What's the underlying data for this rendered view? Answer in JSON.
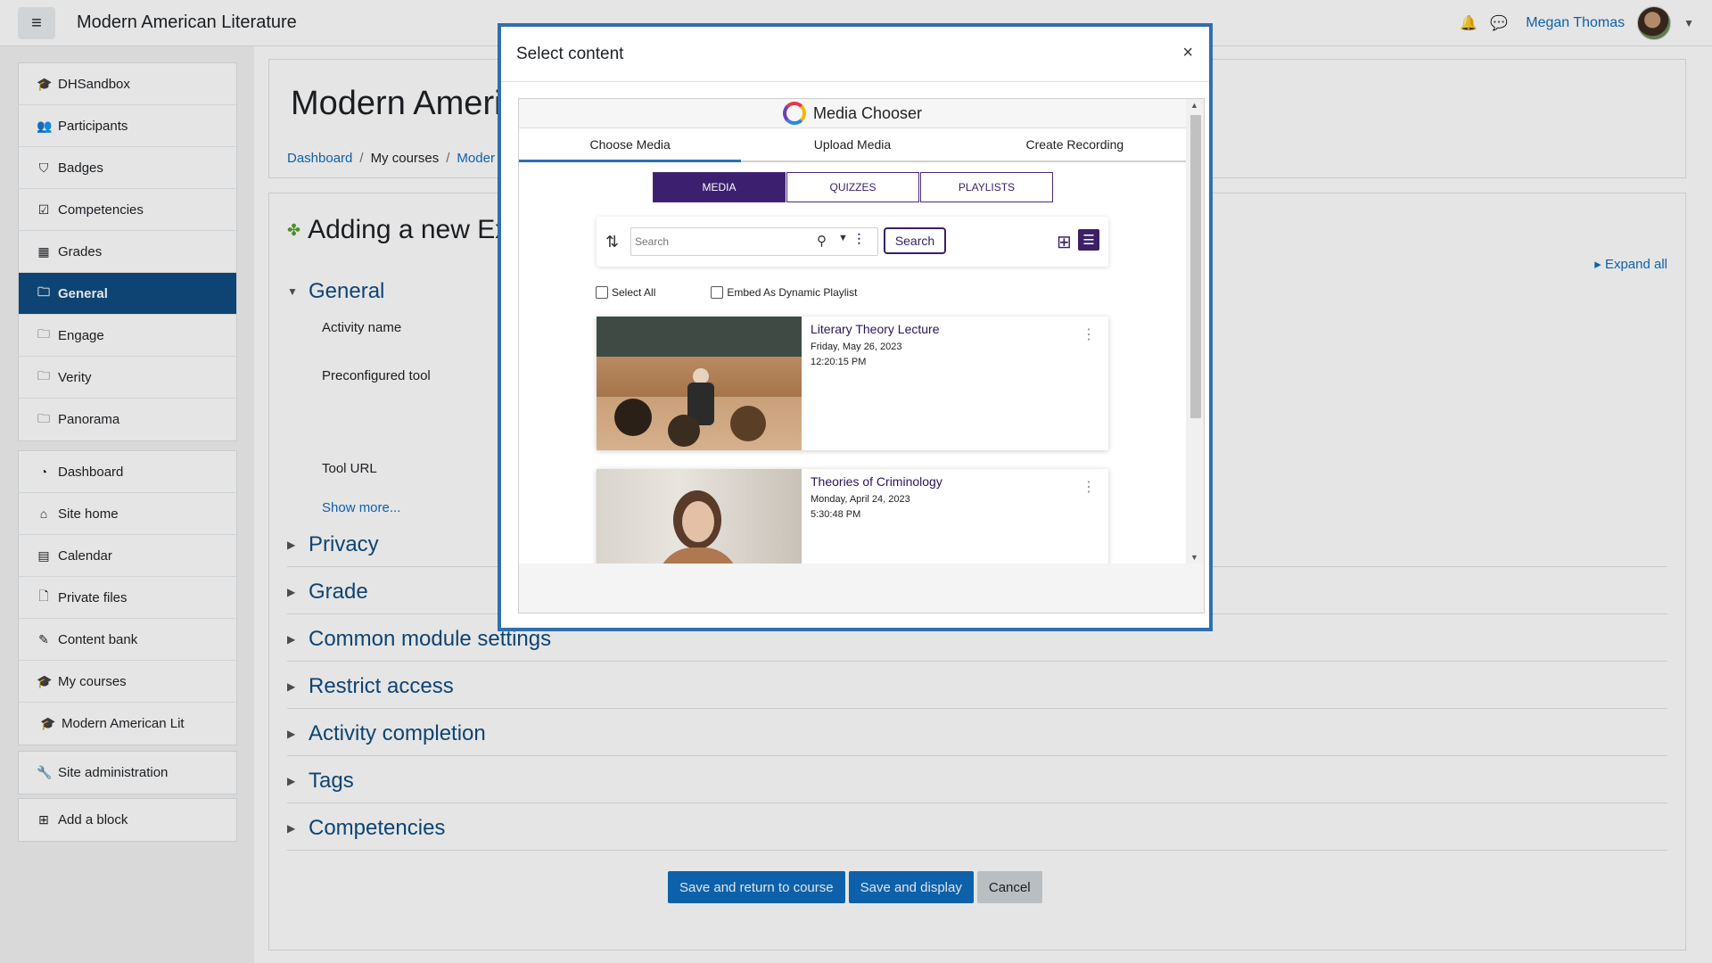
{
  "navbar": {
    "site_title": "Modern American Literature",
    "user_name": "Megan Thomas"
  },
  "drawer": {
    "block1": [
      {
        "label": "DHSandbox",
        "icon": "graduation-cap-icon",
        "glyph": "🎓"
      },
      {
        "label": "Participants",
        "icon": "users-icon",
        "glyph": "👥"
      },
      {
        "label": "Badges",
        "icon": "shield-icon",
        "glyph": "⛉"
      },
      {
        "label": "Competencies",
        "icon": "checkbox-icon",
        "glyph": "☑"
      },
      {
        "label": "Grades",
        "icon": "table-icon",
        "glyph": "▦"
      },
      {
        "label": "General",
        "icon": "folder-icon",
        "glyph": "🗀"
      },
      {
        "label": "Engage",
        "icon": "folder-icon",
        "glyph": "🗀"
      },
      {
        "label": "Verity",
        "icon": "folder-icon",
        "glyph": "🗀"
      },
      {
        "label": "Panorama",
        "icon": "folder-icon",
        "glyph": "🗀"
      }
    ],
    "block2": [
      {
        "label": "Dashboard",
        "icon": "dashboard-icon",
        "glyph": "◔"
      },
      {
        "label": "Site home",
        "icon": "home-icon",
        "glyph": "⌂"
      },
      {
        "label": "Calendar",
        "icon": "calendar-icon",
        "glyph": "▤"
      },
      {
        "label": "Private files",
        "icon": "file-icon",
        "glyph": "🗋"
      },
      {
        "label": "Content bank",
        "icon": "brush-icon",
        "glyph": "✎"
      },
      {
        "label": "My courses",
        "icon": "graduation-cap-icon",
        "glyph": "🎓"
      },
      {
        "label": "Modern American Lit",
        "icon": "graduation-cap-icon",
        "glyph": "🎓"
      }
    ],
    "block3": [
      {
        "label": "Site administration",
        "icon": "wrench-icon",
        "glyph": "🔧"
      }
    ],
    "block4": [
      {
        "label": "Add a block",
        "icon": "plus-square-icon",
        "glyph": "⊞"
      }
    ]
  },
  "header": {
    "course_title": "Modern Americ",
    "breadcrumb": [
      "Dashboard",
      "My courses",
      "Moder"
    ]
  },
  "form": {
    "heading": "Adding a new Ext",
    "expand_all": "Expand all",
    "general": "General",
    "activity_name": "Activity name",
    "preconfigured_tool": "Preconfigured tool",
    "tool_url": "Tool URL",
    "show_more": "Show more...",
    "sections": [
      "Privacy",
      "Grade",
      "Common module settings",
      "Restrict access",
      "Activity completion",
      "Tags",
      "Competencies"
    ],
    "buttons": {
      "save_return": "Save and return to course",
      "save_display": "Save and display",
      "cancel": "Cancel"
    }
  },
  "modal": {
    "title": "Select content",
    "close": "×",
    "media_chooser": {
      "title": "Media Chooser",
      "tabs": [
        "Choose Media",
        "Upload Media",
        "Create Recording"
      ],
      "segments": [
        "MEDIA",
        "QUIZZES",
        "PLAYLISTS"
      ],
      "search_placeholder": "Search",
      "search_button": "Search",
      "select_all": "Select All",
      "embed_playlist": "Embed As Dynamic Playlist",
      "items": [
        {
          "title": "Literary Theory Lecture",
          "date": "Friday, May 26, 2023",
          "time": "12:20:15 PM"
        },
        {
          "title": "Theories of Criminology",
          "date": "Monday, April 24, 2023",
          "time": "5:30:48 PM"
        }
      ]
    }
  },
  "colors": {
    "primary": "#0f6cbf",
    "active_nav": "#0f4c81",
    "purple": "#3d1f70"
  }
}
